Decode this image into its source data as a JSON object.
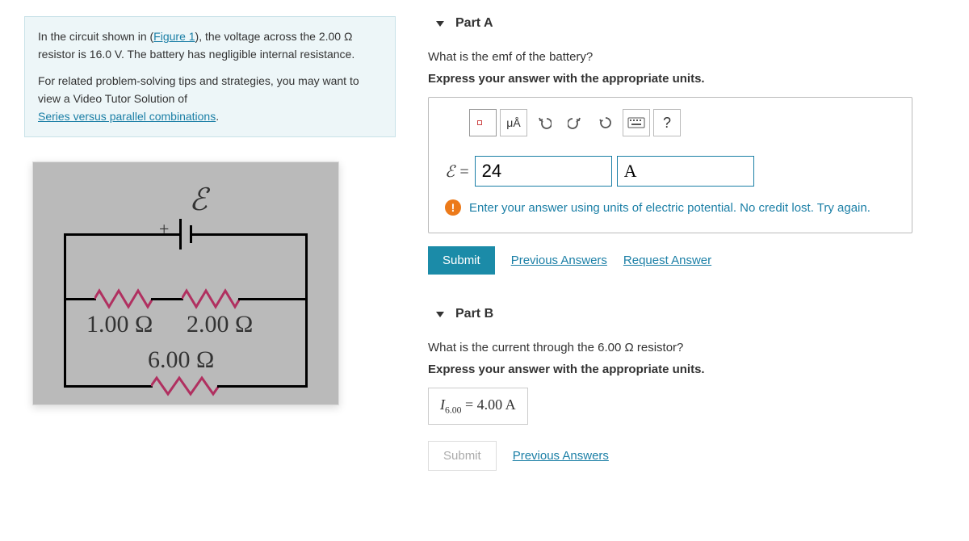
{
  "problem": {
    "intro_prefix": "In the circuit shown in (",
    "figure_link": "Figure 1",
    "intro_suffix": "), the voltage across the 2.00 Ω resistor is 16.0 V. The battery has negligible internal resistance.",
    "tips_prefix": "For related problem-solving tips and strategies, you may want to view a Video Tutor Solution of ",
    "tips_link": "Series versus parallel combinations",
    "tips_suffix": "."
  },
  "circuit": {
    "emf_symbol": "ℰ",
    "plus": "+",
    "r1": "1.00 Ω",
    "r2": "2.00 Ω",
    "r3": "6.00 Ω"
  },
  "partA": {
    "title": "Part A",
    "question": "What is the emf of the battery?",
    "instruction": "Express your answer with the appropriate units.",
    "var_label": "ℰ =",
    "value": "24",
    "unit": "A",
    "units_btn": "μÅ",
    "help_btn": "?",
    "feedback": "Enter your answer using units of electric potential. No credit lost. Try again.",
    "submit": "Submit",
    "prev": "Previous Answers",
    "request": "Request Answer"
  },
  "partB": {
    "title": "Part B",
    "question": "What is the current through the 6.00 Ω resistor?",
    "instruction": "Express your answer with the appropriate units.",
    "result_var": "I",
    "result_sub": "6.00",
    "result_eq": " = ",
    "result_val": "4.00 A",
    "submit": "Submit",
    "prev": "Previous Answers"
  }
}
